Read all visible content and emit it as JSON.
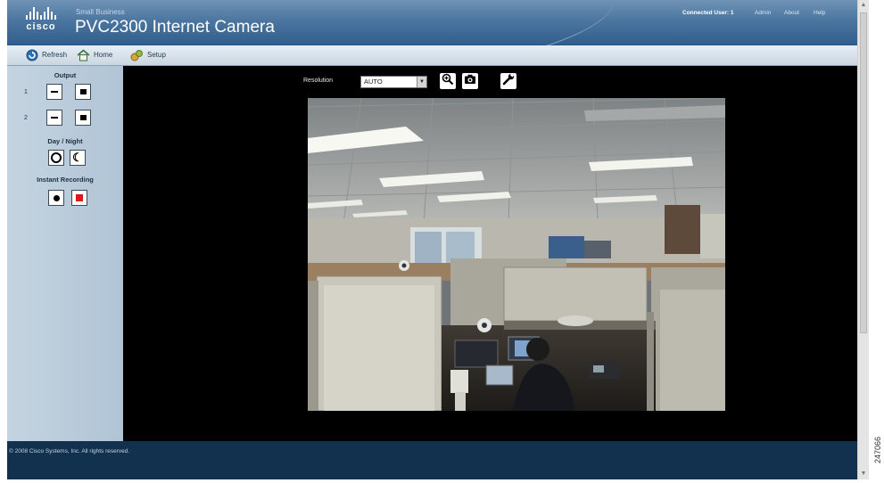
{
  "header": {
    "logo_text": "cisco",
    "subtitle": "Small Business",
    "title": "PVC2300 Internet Camera",
    "connected_users": "Connected User: 1",
    "links": [
      "Admin",
      "About",
      "Help"
    ]
  },
  "toolbar": {
    "items": [
      {
        "label": "Refresh",
        "icon": "refresh-icon"
      },
      {
        "label": "Home",
        "icon": "home-icon"
      },
      {
        "label": "Setup",
        "icon": "setup-icon"
      }
    ]
  },
  "left_panel": {
    "output_label": "Output",
    "output_rows": [
      "1",
      "2"
    ],
    "day_night_label": "Day / Night",
    "instant_recording_label": "Instant Recording"
  },
  "main": {
    "resolution_label": "Resolution",
    "resolution_value": "AUTO"
  },
  "footer": {
    "copyright": "© 2008 Cisco Systems, Inc. All rights reserved."
  },
  "figure_id": "247066",
  "colors": {
    "header_blue": "#4c76a0",
    "panel_blue": "#bccdda",
    "footer_navy": "#11314f",
    "record_red": "#d91a1a"
  }
}
